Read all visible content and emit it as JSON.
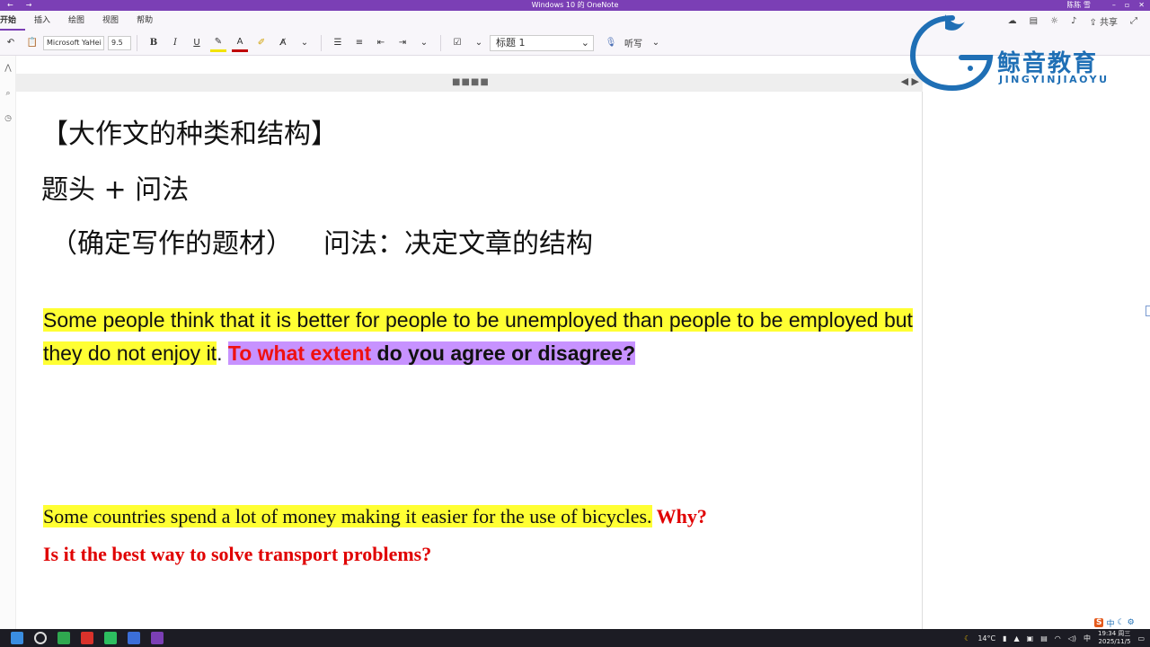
{
  "window": {
    "title": "Windows 10 的 OneNote",
    "user": "陈陈 雪"
  },
  "ribbon": {
    "tabs": [
      "开始",
      "插入",
      "绘图",
      "视图",
      "帮助"
    ],
    "share_label": "共享"
  },
  "toolbar": {
    "font_name": "Microsoft YaHei",
    "font_size": "9.5",
    "bold": "B",
    "italic": "I",
    "underline": "U",
    "font_color": "A",
    "style_value": "标题 1",
    "dictate_label": "听写"
  },
  "note": {
    "heading1": "【大作文的种类和结构】",
    "heading2": "题头 + 问法",
    "heading3_a": "（确定写作的题材）",
    "heading3_b": "问法：决定文章的结构",
    "q1_part1": "Some people think that it is better for people to be unemployed than people to be employed but they do not enjoy it",
    "q1_period": ".",
    "q1_red": "To what extent",
    "q1_purple": " do you agree or disagree?",
    "q2_part1": "Some countries spend a lot of money making it easier for the use of bicycles.",
    "q2_red1": " Why?",
    "q2_red2": "Is it the best way to solve transport problems?"
  },
  "watermark": {
    "name": "鲸音教育",
    "pinyin": "JINGYINJIAOYU"
  },
  "taskbar": {
    "temperature": "14°C",
    "time": "19:34 周三",
    "date": "2025/11/5",
    "ime_lang": "中"
  },
  "colors": {
    "accent": "#7b3fb5",
    "highlight_yellow": "#ffff33",
    "highlight_purple": "#c792ff",
    "text_red": "#ee1111",
    "logo_blue": "#1f6fb5"
  }
}
